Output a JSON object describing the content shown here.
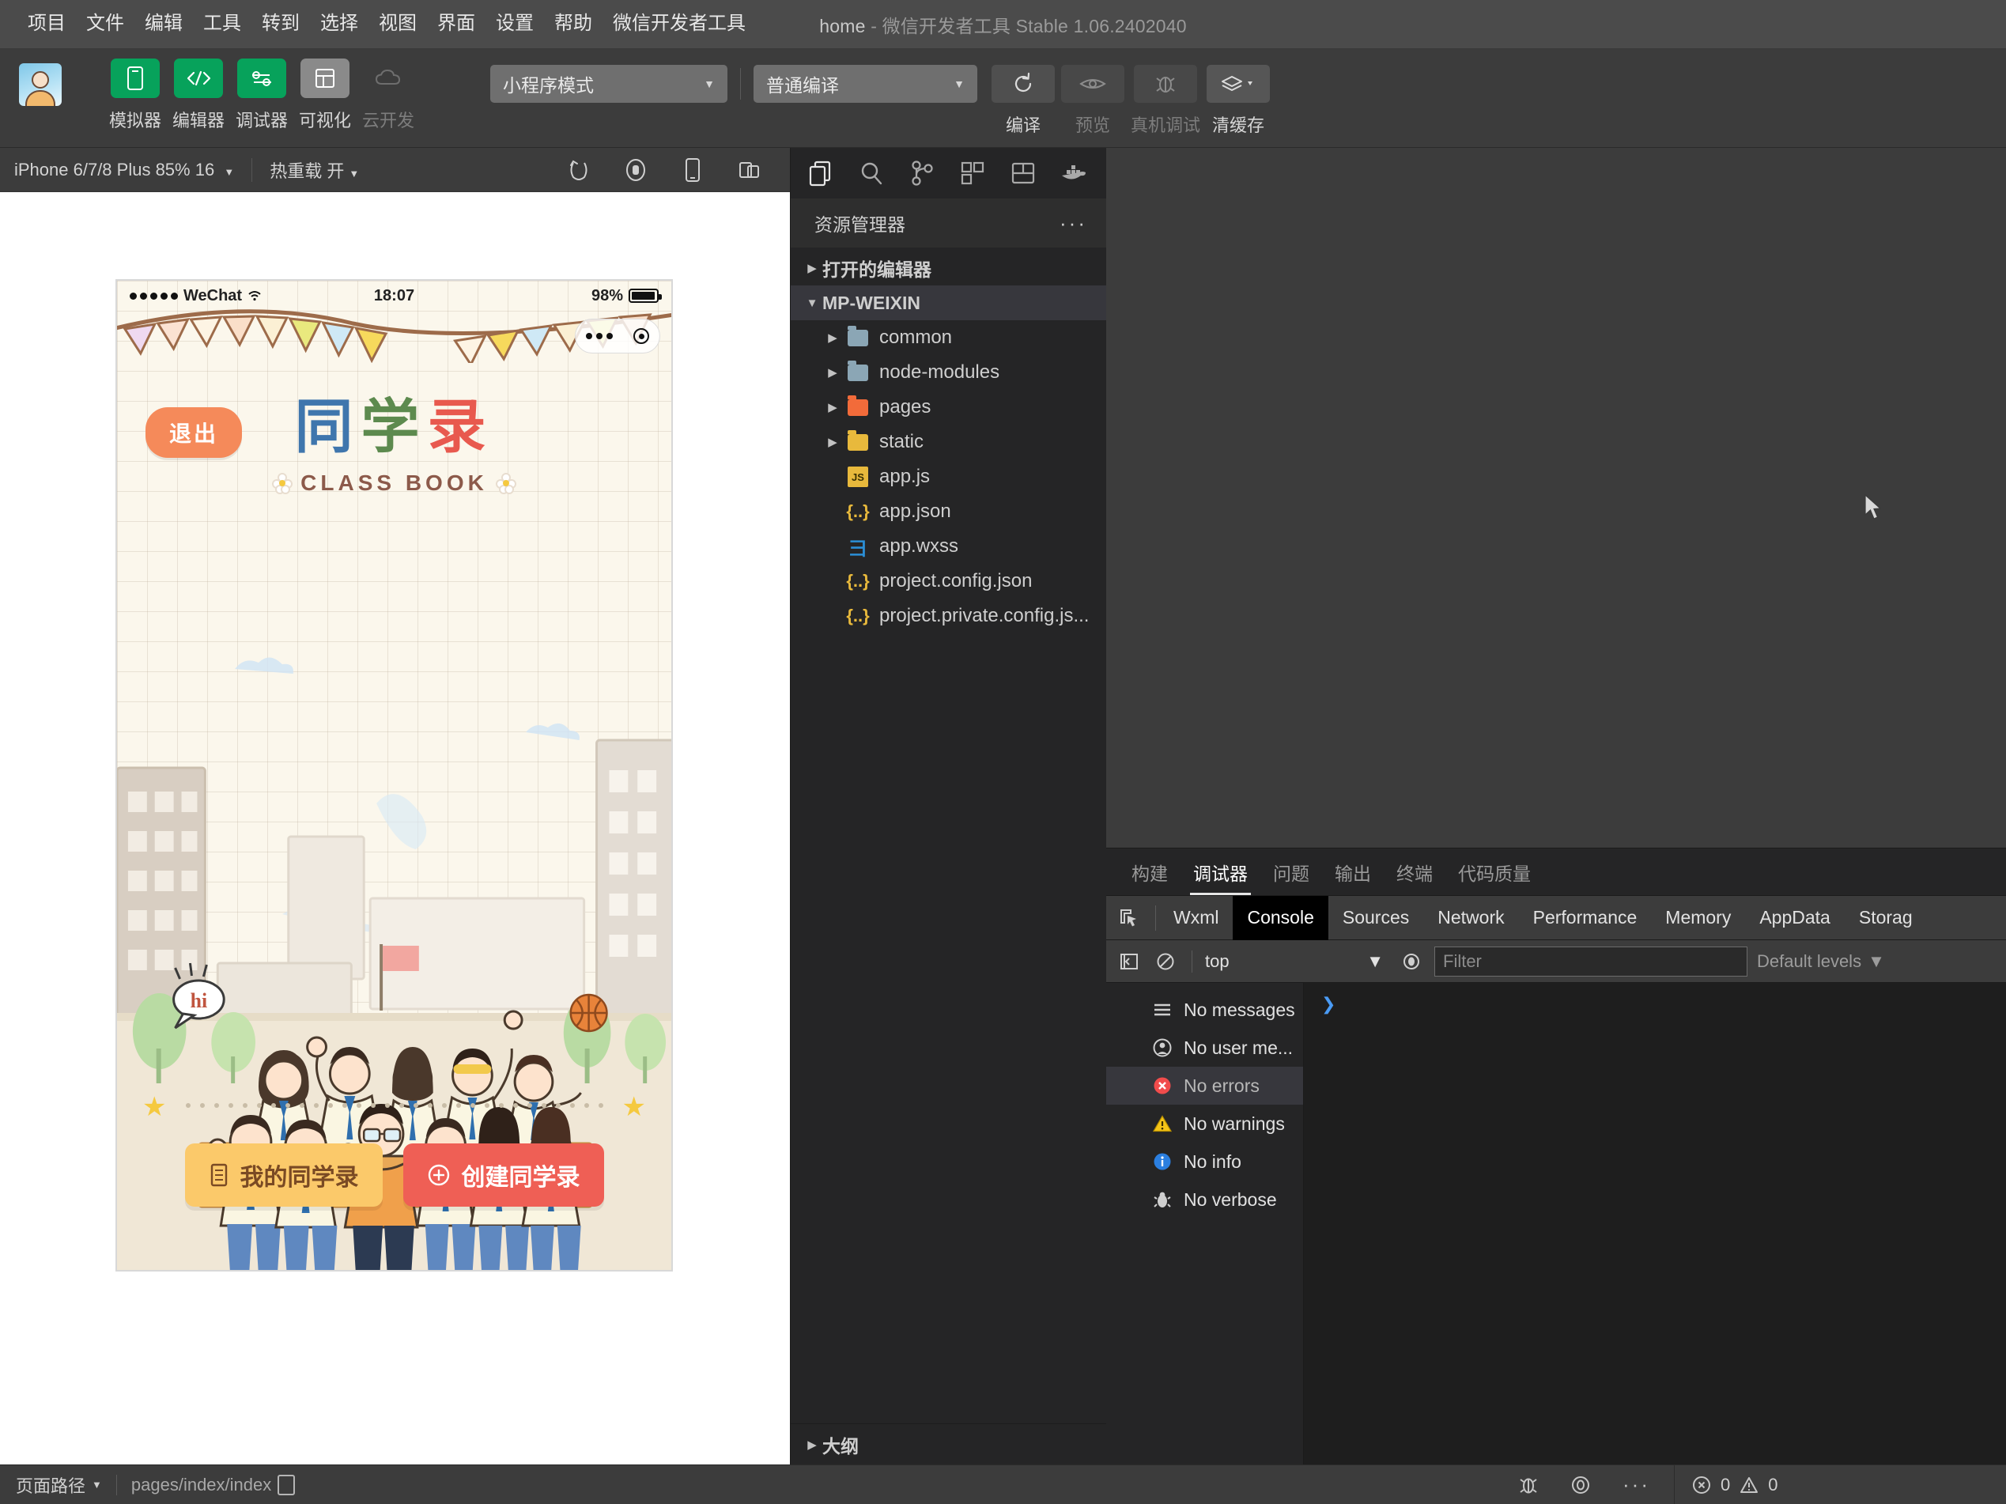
{
  "titlebar": {
    "menus": [
      "项目",
      "文件",
      "编辑",
      "工具",
      "转到",
      "选择",
      "视图",
      "界面",
      "设置",
      "帮助",
      "微信开发者工具"
    ],
    "project": "home",
    "dash": "-",
    "app": "微信开发者工具 Stable 1.06.2402040"
  },
  "toolbar": {
    "left_buttons": [
      {
        "label": "模拟器",
        "icon": "phone-icon",
        "style": "green"
      },
      {
        "label": "编辑器",
        "icon": "code-icon",
        "style": "green"
      },
      {
        "label": "调试器",
        "icon": "sliders-icon",
        "style": "green"
      },
      {
        "label": "可视化",
        "icon": "layout-icon",
        "style": "gray"
      },
      {
        "label": "云开发",
        "icon": "cloud-icon",
        "style": "ghost"
      }
    ],
    "mode_select": "小程序模式",
    "compile_select": "普通编译",
    "right_buttons": [
      {
        "label": "编译",
        "icon": "refresh-icon",
        "dim": false
      },
      {
        "label": "预览",
        "icon": "eye-icon",
        "dim": true
      },
      {
        "label": "真机调试",
        "icon": "bug-icon",
        "dim": true
      },
      {
        "label": "清缓存",
        "icon": "layers-icon",
        "dim": false
      }
    ]
  },
  "simulator": {
    "device_select": "iPhone 6/7/8 Plus 85% 16",
    "hotreload_label": "热重载",
    "hotreload_value": "开",
    "icons": [
      "rotate-icon",
      "record-icon",
      "device-icon",
      "window-icon"
    ],
    "phone": {
      "status": {
        "carrier": "WeChat",
        "time": "18:07",
        "battery": "98%"
      },
      "exit_label": "退出",
      "logo_chars": [
        "同",
        "学",
        "录"
      ],
      "logo_en": "CLASS BOOK",
      "speech_bubble": "hi",
      "cta": [
        {
          "label": "我的同学录",
          "icon": "book-icon",
          "style": "yellow"
        },
        {
          "label": "创建同学录",
          "icon": "plus-circle-icon",
          "style": "red"
        }
      ]
    }
  },
  "explorer": {
    "activity_icons": [
      "files-icon",
      "search-icon",
      "source-control-icon",
      "extensions-icon",
      "layout-icon",
      "docker-icon"
    ],
    "header": "资源管理器",
    "more": "···",
    "sections": [
      {
        "label": "打开的编辑器",
        "expanded": false
      },
      {
        "label": "MP-WEIXIN",
        "expanded": true
      }
    ],
    "files": [
      {
        "name": "common",
        "type": "folder",
        "color": "blue",
        "arrow": true
      },
      {
        "name": "node-modules",
        "type": "folder",
        "color": "blue",
        "arrow": true
      },
      {
        "name": "pages",
        "type": "folder",
        "color": "orange",
        "arrow": true
      },
      {
        "name": "static",
        "type": "folder",
        "color": "yellow",
        "arrow": true
      },
      {
        "name": "app.js",
        "type": "js",
        "arrow": false
      },
      {
        "name": "app.json",
        "type": "json",
        "arrow": false
      },
      {
        "name": "app.wxss",
        "type": "css",
        "arrow": false
      },
      {
        "name": "project.config.json",
        "type": "json",
        "arrow": false
      },
      {
        "name": "project.private.config.js...",
        "type": "json",
        "arrow": false
      }
    ],
    "outline": "大纲"
  },
  "debug": {
    "tabs": [
      {
        "label": "构建",
        "active": false
      },
      {
        "label": "调试器",
        "active": true
      },
      {
        "label": "问题",
        "active": false
      },
      {
        "label": "输出",
        "active": false
      },
      {
        "label": "终端",
        "active": false
      },
      {
        "label": "代码质量",
        "active": false
      }
    ],
    "devtools_tabs": [
      {
        "label": "Wxml",
        "active": false
      },
      {
        "label": "Console",
        "active": true
      },
      {
        "label": "Sources",
        "active": false
      },
      {
        "label": "Network",
        "active": false
      },
      {
        "label": "Performance",
        "active": false
      },
      {
        "label": "Memory",
        "active": false
      },
      {
        "label": "AppData",
        "active": false
      },
      {
        "label": "Storag",
        "active": false
      }
    ],
    "console": {
      "context": "top",
      "filter_placeholder": "Filter",
      "levels": "Default levels",
      "sidebar": [
        {
          "label": "No messages",
          "icon": "list-icon",
          "selected": false
        },
        {
          "label": "No user me...",
          "icon": "user-icon",
          "selected": false
        },
        {
          "label": "No errors",
          "icon": "error-icon",
          "selected": true
        },
        {
          "label": "No warnings",
          "icon": "warning-icon",
          "selected": false
        },
        {
          "label": "No info",
          "icon": "info-icon",
          "selected": false
        },
        {
          "label": "No verbose",
          "icon": "verbose-icon",
          "selected": false
        }
      ],
      "prompt": "❯"
    }
  },
  "statusbar": {
    "page_path_label": "页面路径",
    "page_path_value": "pages/index/index",
    "icons": [
      "bug-icon",
      "eye-icon",
      "more-icon"
    ],
    "errors": "0",
    "warnings": "0"
  },
  "colors": {
    "green": "#07a25b",
    "accent_red": "#ef5f55",
    "accent_yellow": "#fbc96a",
    "exit_orange": "#f58a5a"
  }
}
